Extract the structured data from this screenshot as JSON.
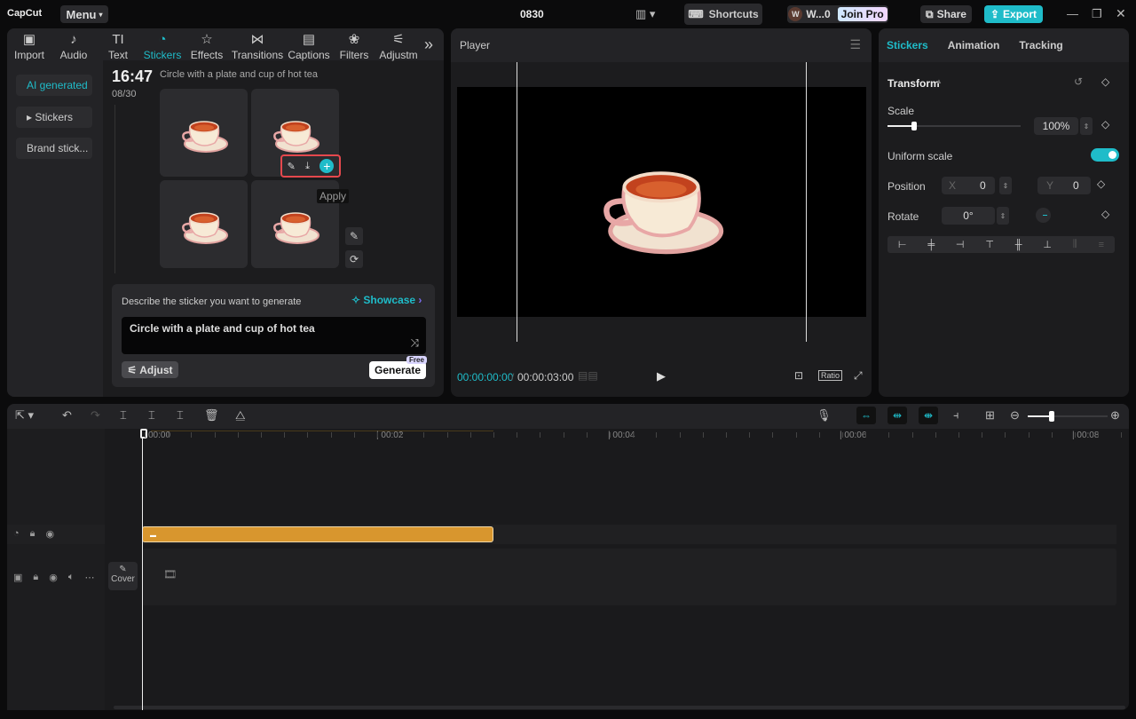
{
  "app": {
    "logo": "CapCut",
    "menu": "Menu",
    "project_title": "0830",
    "shortcuts": "Shortcuts",
    "user": "W...0",
    "user_initial": "W",
    "join_pro": "Join Pro",
    "share": "Share",
    "export": "Export"
  },
  "toolbar_tabs": [
    {
      "label": "Import",
      "icon": "▣"
    },
    {
      "label": "Audio",
      "icon": "♪"
    },
    {
      "label": "Text",
      "icon": "TI"
    },
    {
      "label": "Stickers",
      "icon": "◔"
    },
    {
      "label": "Effects",
      "icon": "☆"
    },
    {
      "label": "Transitions",
      "icon": "⋈"
    },
    {
      "label": "Captions",
      "icon": "▤"
    },
    {
      "label": "Filters",
      "icon": "❀"
    },
    {
      "label": "Adjustm",
      "icon": "⚟"
    }
  ],
  "sidebar": {
    "items": [
      "AI generated",
      "▸ Stickers",
      "Brand stick..."
    ]
  },
  "generation": {
    "time": "16:47",
    "date": "08/30",
    "prompt_title": "Circle with a plate and cup of hot tea",
    "tooltip": "Apply"
  },
  "prompt_box": {
    "label": "Describe the sticker you want to generate",
    "showcase": "Showcase",
    "value": "Circle with a plate and cup of hot tea",
    "adjust": "Adjust",
    "generate": "Generate",
    "free_badge": "Free"
  },
  "player": {
    "title": "Player",
    "current_time": "00:00:00:00",
    "total_time": "00:00:03:00",
    "ratio": "Ratio"
  },
  "inspector": {
    "tabs": [
      "Stickers",
      "Animation",
      "Tracking"
    ],
    "section": "Transform",
    "scale_label": "Scale",
    "scale_value": "100%",
    "scale_fraction": 0.2,
    "uniform_scale": "Uniform scale",
    "uniform_on": true,
    "position_label": "Position",
    "x_label": "X",
    "x_value": "0",
    "y_label": "Y",
    "y_value": "0",
    "rotate_label": "Rotate",
    "rotate_value": "0°"
  },
  "timeline": {
    "ruler": [
      "00:00",
      "| 00:02",
      "| 00:04",
      "| 00:06",
      "| 00:08"
    ],
    "cover": "Cover",
    "zoom_fraction": 0.3
  },
  "colors": {
    "accent": "#1fbcc9",
    "clip": "#d8962e",
    "highlight": "#e5484d"
  }
}
